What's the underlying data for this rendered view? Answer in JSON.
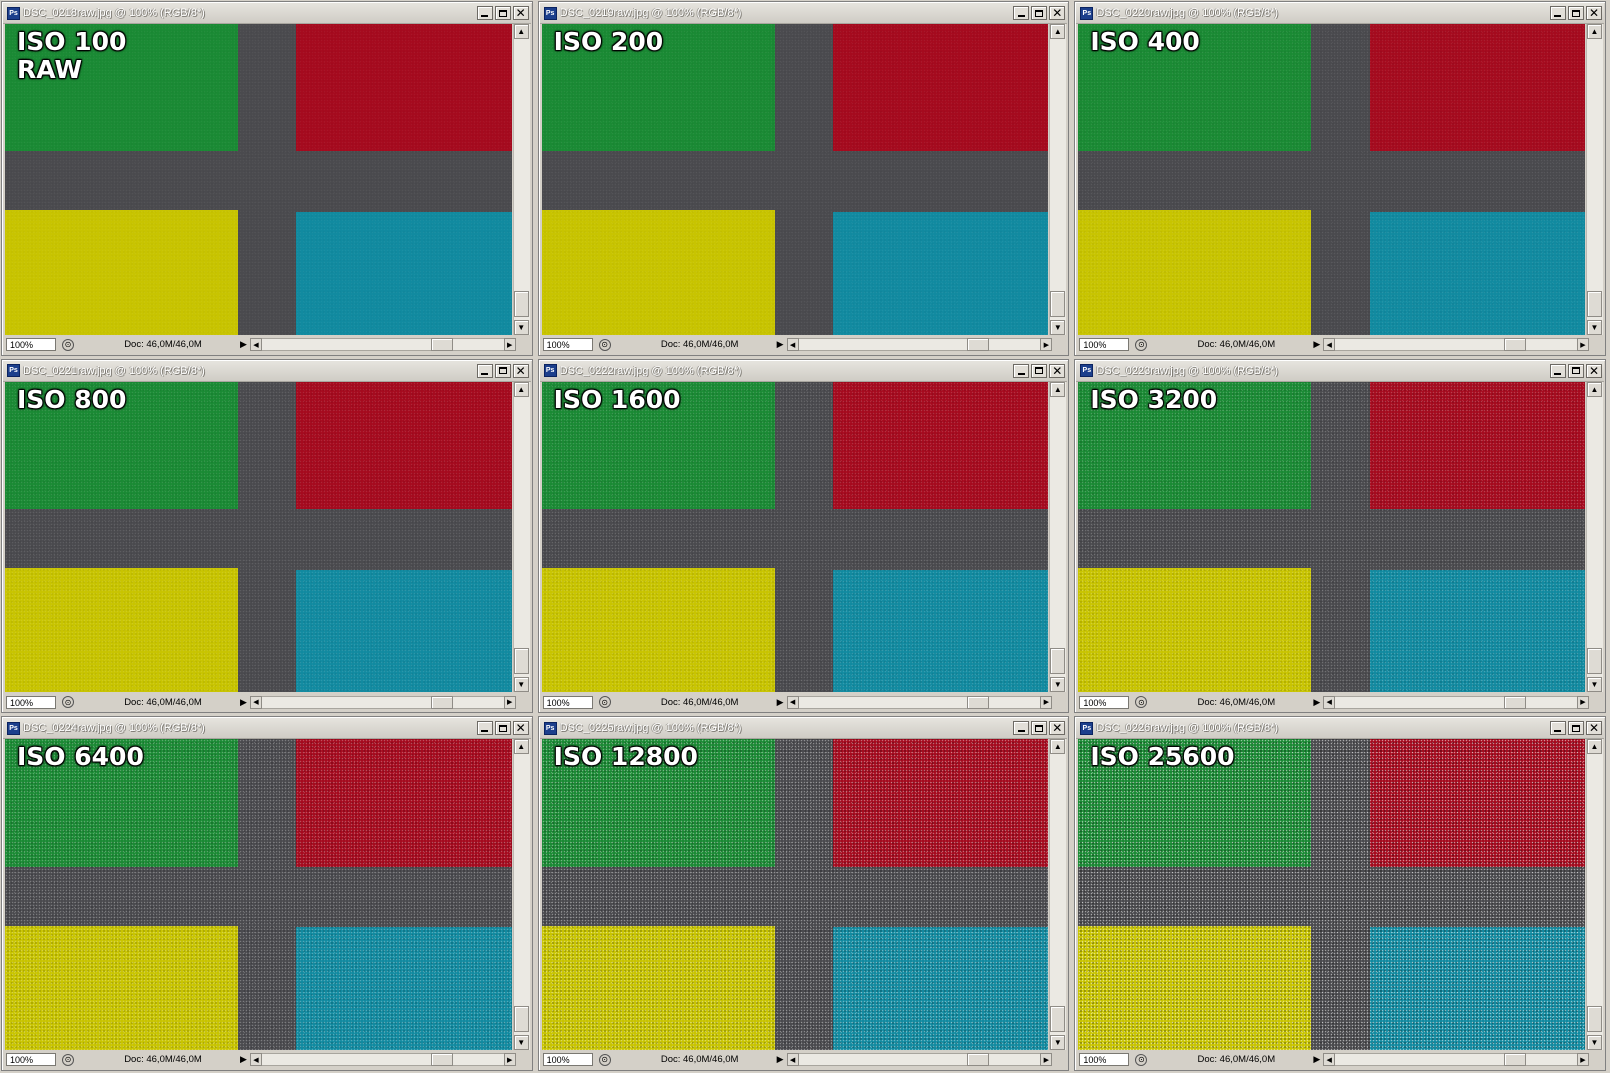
{
  "colors": {
    "background": "#4a4a4e",
    "green": "#1a8a34",
    "red": "#a50a1e",
    "yellow": "#c8c400",
    "cyan": "#118aa0"
  },
  "windows": [
    {
      "title": "DSC_0218raw.jpg @ 100% (RGB/8*)",
      "label": "ISO 100\nRAW",
      "zoom": "100%",
      "doc": "Doc: 46,0M/46,0M",
      "noise": 0.08
    },
    {
      "title": "DSC_0219raw.jpg @ 100% (RGB/8*)",
      "label": "ISO 200",
      "zoom": "100%",
      "doc": "Doc: 46,0M/46,0M",
      "noise": 0.1
    },
    {
      "title": "DSC_0220raw.jpg @ 100% (RGB/8*)",
      "label": "ISO 400",
      "zoom": "100%",
      "doc": "Doc: 46,0M/46,0M",
      "noise": 0.14
    },
    {
      "title": "DSC_0221raw.jpg @ 100% (RGB/8*)",
      "label": "ISO 800",
      "zoom": "100%",
      "doc": "Doc: 46,0M/46,0M",
      "noise": 0.2
    },
    {
      "title": "DSC_0222raw.jpg @ 100% (RGB/8*)",
      "label": "ISO 1600",
      "zoom": "100%",
      "doc": "Doc: 46,0M/46,0M",
      "noise": 0.28
    },
    {
      "title": "DSC_0223raw.jpg @ 100% (RGB/8*)",
      "label": "ISO 3200",
      "zoom": "100%",
      "doc": "Doc: 46,0M/46,0M",
      "noise": 0.38
    },
    {
      "title": "DSC_0224raw.jpg @ 100% (RGB/8*)",
      "label": "ISO 6400",
      "zoom": "100%",
      "doc": "Doc: 46,0M/46,0M",
      "noise": 0.5
    },
    {
      "title": "DSC_0225raw.jpg @ 100% (RGB/8*)",
      "label": "ISO 12800",
      "zoom": "100%",
      "doc": "Doc: 46,0M/46,0M",
      "noise": 0.7
    },
    {
      "title": "DSC_0226raw.jpg @ 100% (RGB/8*)",
      "label": "ISO 25600",
      "zoom": "100%",
      "doc": "Doc: 46,0M/46,0M",
      "noise": 0.95
    }
  ]
}
